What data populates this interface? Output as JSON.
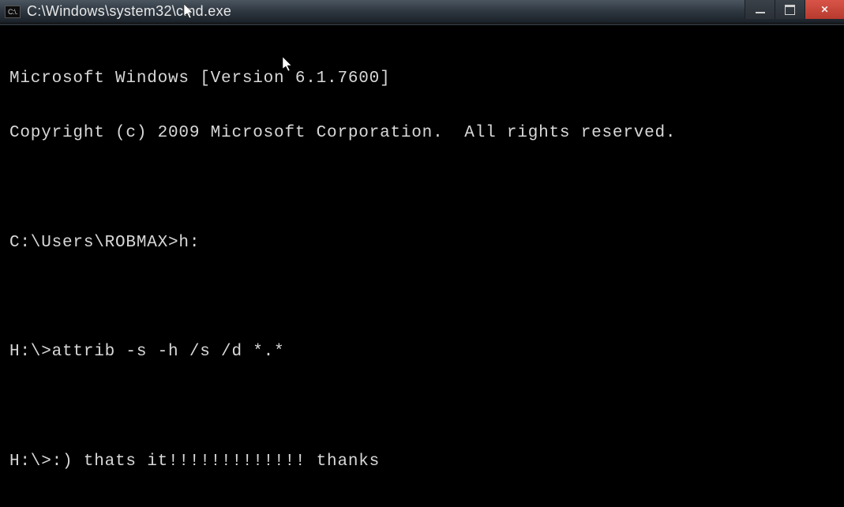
{
  "titlebar": {
    "icon_label": "C:\\.",
    "title": "C:\\Windows\\system32\\cmd.exe"
  },
  "terminal": {
    "lines": [
      "Microsoft Windows [Version 6.1.7600]",
      "Copyright (c) 2009 Microsoft Corporation.  All rights reserved.",
      "",
      "C:\\Users\\ROBMAX>h:",
      "",
      "H:\\>attrib -s -h /s /d *.*",
      "",
      "H:\\>:) thats it!!!!!!!!!!!!! thanks"
    ]
  }
}
